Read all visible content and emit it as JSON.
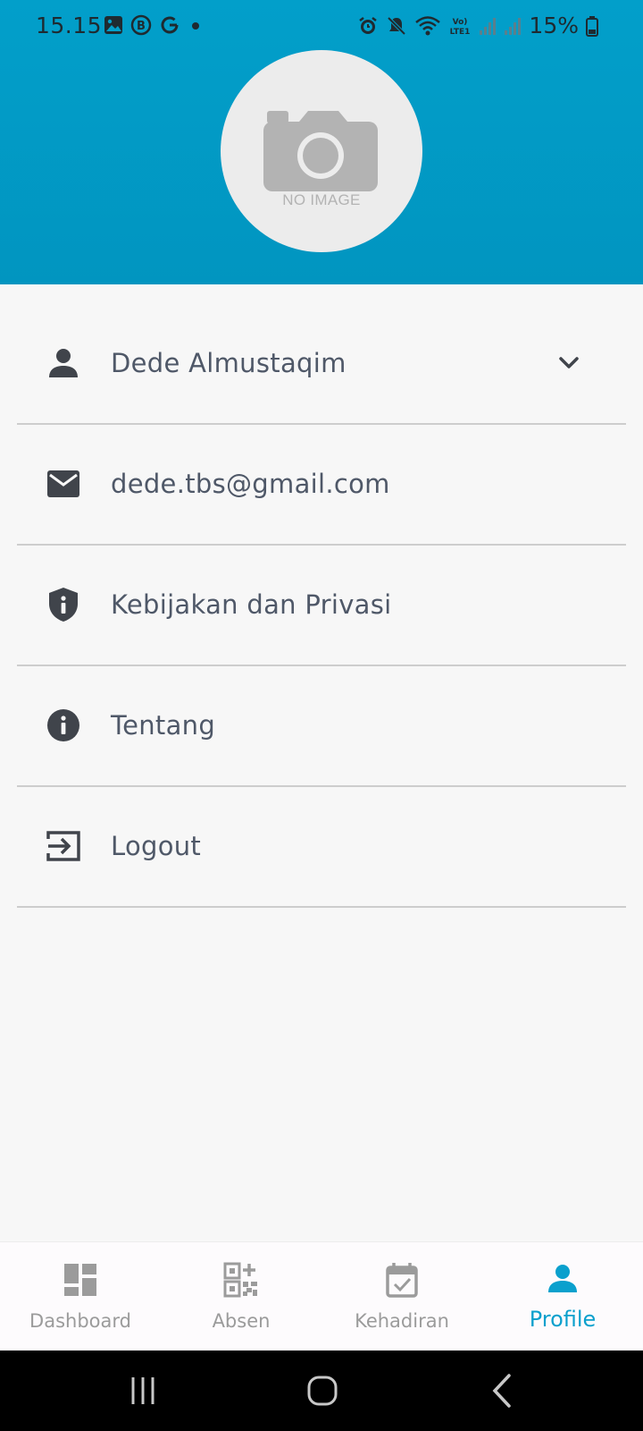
{
  "status_bar": {
    "time": "15.15",
    "battery": "15%",
    "left_icons": [
      "image-icon",
      "b-badge-icon",
      "g-app-icon",
      "dot-icon"
    ],
    "right_icons": [
      "alarm-icon",
      "mute-icon",
      "wifi-icon",
      "lte-icon",
      "signal-icon",
      "signal-icon",
      "battery-icon"
    ]
  },
  "profile": {
    "avatar_placeholder": "NO IMAGE",
    "avatar_icon": "camera-icon"
  },
  "menu": {
    "items": [
      {
        "label": "Dede Almustaqim",
        "icon": "person-icon",
        "trailing": "chevron-down-icon"
      },
      {
        "label": "dede.tbs@gmail.com",
        "icon": "email-icon"
      },
      {
        "label": "Kebijakan dan Privasi",
        "icon": "shield-info-icon"
      },
      {
        "label": "Tentang",
        "icon": "info-icon"
      },
      {
        "label": "Logout",
        "icon": "logout-icon"
      }
    ]
  },
  "bottom_nav": {
    "active": "Profile",
    "items": [
      {
        "label": "Dashboard",
        "icon": "dashboard-icon"
      },
      {
        "label": "Absen",
        "icon": "qr-code-icon"
      },
      {
        "label": "Kehadiran",
        "icon": "calendar-check-icon"
      },
      {
        "label": "Profile",
        "icon": "person-icon"
      }
    ]
  },
  "colors": {
    "header": "#029fca",
    "accent": "#0aa0cd",
    "text": "#4f5868",
    "icon": "#40444b",
    "nav_inactive": "#9b9b9b"
  }
}
